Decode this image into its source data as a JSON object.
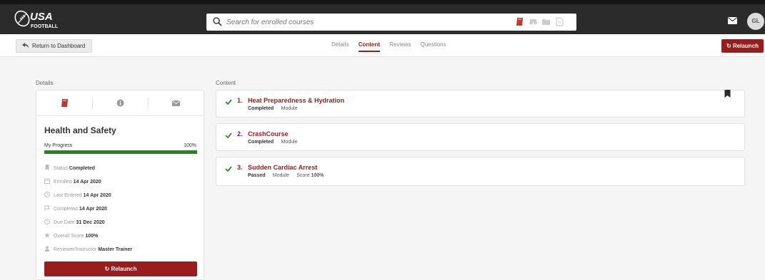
{
  "header": {
    "logo_text": "USA FOOTBALL",
    "search_placeholder": "Search for enrolled courses",
    "avatar_initials": "GL"
  },
  "subnav": {
    "back_label": "Return to Dashboard",
    "tabs": [
      {
        "label": "Details",
        "active": false
      },
      {
        "label": "Content",
        "active": true
      },
      {
        "label": "Reviews",
        "active": false
      },
      {
        "label": "Questions",
        "active": false
      }
    ],
    "relaunch_label": "Relaunch"
  },
  "details": {
    "section_label": "Details",
    "tab_icons": [
      "course-book-icon",
      "info-icon",
      "envelope-icon"
    ],
    "course_title": "Health and Safety",
    "progress_label": "My Progress",
    "progress_text": "100%",
    "progress_fraction": 1.0,
    "rows": [
      {
        "icon": "bookmark-icon",
        "label": "Status",
        "value": "Completed"
      },
      {
        "icon": "calendar-icon",
        "label": "Enrolled",
        "value": "14 Apr 2020"
      },
      {
        "icon": "clock-icon",
        "label": "Last Entered",
        "value": "14 Apr 2020"
      },
      {
        "icon": "flag-icon",
        "label": "Completed",
        "value": "14 Apr 2020"
      },
      {
        "icon": "clock-icon",
        "label": "Due Date",
        "value": "31 Dec 2020"
      },
      {
        "icon": "star-icon",
        "label": "Overall Score",
        "value": "100%"
      },
      {
        "icon": "user-icon",
        "label": "Reviewer/Instructor",
        "value": "Master Trainer"
      }
    ],
    "relaunch_label": "Relaunch"
  },
  "content": {
    "section_label": "Content",
    "items": [
      {
        "number": "1.",
        "title": "Heat Preparedness & Hydration",
        "status": "Completed",
        "type": "Module",
        "score_label": "",
        "score": ""
      },
      {
        "number": "2.",
        "title": "CrashCourse",
        "status": "Completed",
        "type": "Module",
        "score_label": "",
        "score": ""
      },
      {
        "number": "3.",
        "title": "Sudden Cardiac Arrest",
        "status": "Passed",
        "type": "Module",
        "score_label": "Score",
        "score": "100%"
      }
    ]
  },
  "colors": {
    "accent": "#9b1c1c",
    "topbar": "#2b2b2b",
    "progress": "#1e8a1e",
    "check": "#2e8b2e"
  }
}
